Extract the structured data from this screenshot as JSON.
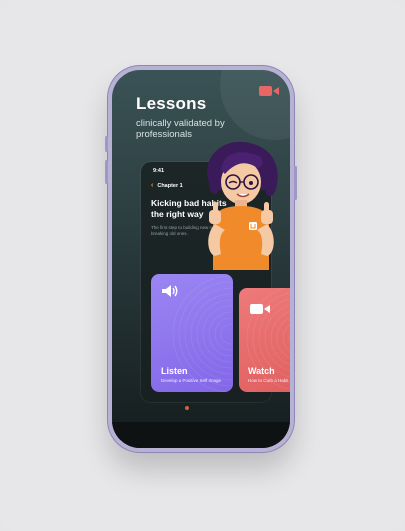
{
  "screen": {
    "title": "Lessons",
    "subtitle": "clinically validated by professionals",
    "camera_icon": "video-camera-icon"
  },
  "preview": {
    "time": "9:41",
    "chapter": "Chapter 1",
    "headline": "Kicking bad habits the right way",
    "blurb": "The first step to building new routines is breaking old ones."
  },
  "cards": {
    "listen": {
      "label": "Listen",
      "sub": "Develop a Positive Self Image",
      "icon": "speaker-icon",
      "color": "#8a6ff0"
    },
    "watch": {
      "label": "Watch",
      "sub": "How to Curb a Habit",
      "icon": "video-camera-icon",
      "color": "#e86666"
    }
  },
  "colors": {
    "accent": "#e86666",
    "listen": "#8a6ff0",
    "phone_frame": "#b7b1d3"
  }
}
